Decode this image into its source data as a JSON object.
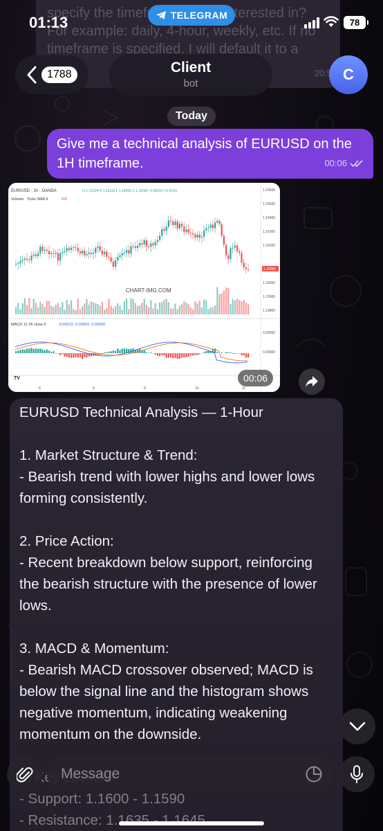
{
  "status_bar": {
    "time": "01:13",
    "pill": "TELEGRAM",
    "battery": "78"
  },
  "ghost_message": {
    "text": "specify the timeframe you're interested in? For example: daily, 4-hour, weekly, etc. If no timeframe is specified, I will default it to a daily",
    "time": "20:5"
  },
  "header": {
    "back_count": "1788",
    "title": "Client",
    "subtitle": "bot",
    "avatar_letter": "C"
  },
  "date_separator": "Today",
  "outgoing_message": {
    "text": "Give me a technical analysis of EURUSD on the 1H timeframe.",
    "time": "00:06"
  },
  "chart_image": {
    "symbol_line": "EUR/USD · 1h · OANDA",
    "ohlc": "O 1.16104  H 1.16113  L 1.16091  C 1.16092  -0.00012 (-0.01%)",
    "volume_label": "Volume · Ticks SMA 9",
    "volume_value": "200",
    "watermark": "CHART-IMG.COM",
    "macd_label": "MACD 12 26 close 9",
    "macd_values": "-0.00013  -0.00063  -0.00050",
    "price_ticks": [
      "1.16600",
      "1.16500",
      "1.16400",
      "1.16300",
      "1.16200",
      "1.16000",
      "1.15900",
      "1.15800"
    ],
    "current_price": "1.16092",
    "macd_ticks": [
      "0.00050",
      "0.00000"
    ],
    "x_ticks": [
      "6",
      "8",
      "9",
      "10",
      "11"
    ],
    "logo": "TV",
    "time": "00:06"
  },
  "incoming_message": {
    "paragraphs": [
      "EURUSD Technical Analysis — 1-Hour",
      "1. Market Structure & Trend:\n- Bearish trend with lower highs and lower lows forming consistently.",
      "2. Price Action:\n- Recent breakdown below support, reinforcing the bearish structure with the presence of lower lows.",
      "3. MACD & Momentum:\n- Bearish MACD crossover observed; MACD is below the signal line and the histogram shows negative momentum, indicating weakening momentum on the downside.",
      "4. Key Levels:\n- Support: 1.1600 - 1.1590\n- Resistance: 1.1635 - 1.1645"
    ]
  },
  "input": {
    "placeholder": "Message"
  },
  "colors": {
    "outgoing": "#7c3fdc",
    "telegram_pill": "#2f8ee6",
    "bull": "#26a69a",
    "bear": "#ef5350",
    "avatar": "#5a78f0"
  }
}
